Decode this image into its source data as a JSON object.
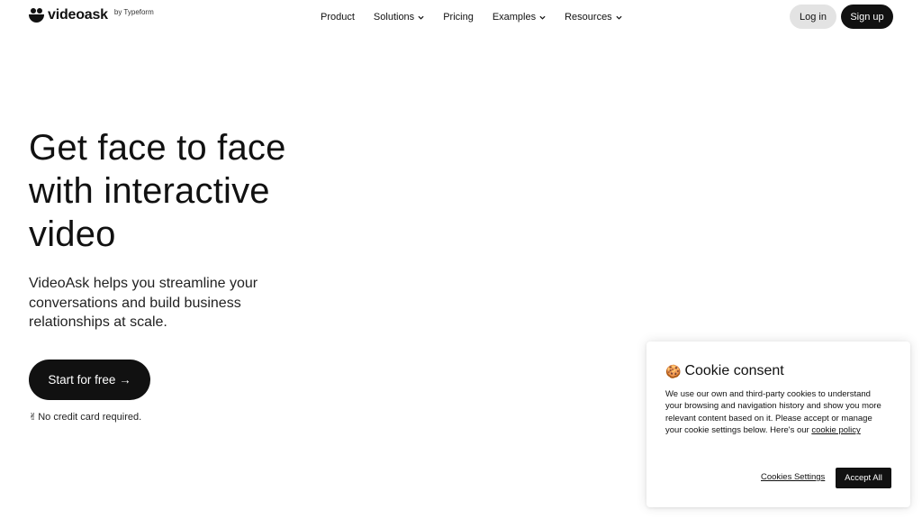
{
  "header": {
    "logo_word": "videoask",
    "logo_by": "by Typeform",
    "nav": [
      {
        "label": "Product",
        "has_dropdown": false
      },
      {
        "label": "Solutions",
        "has_dropdown": true
      },
      {
        "label": "Pricing",
        "has_dropdown": false
      },
      {
        "label": "Examples",
        "has_dropdown": true
      },
      {
        "label": "Resources",
        "has_dropdown": true
      }
    ],
    "login_label": "Log in",
    "signup_label": "Sign up"
  },
  "hero": {
    "title_lines": [
      "Get face to face",
      "with interactive",
      "video"
    ],
    "subtitle_lines": [
      "VideoAsk helps you streamline your",
      "conversations and build business",
      "relationships at scale."
    ],
    "cta_label": "Start for free →",
    "note_emoji": "✌",
    "note_text": "No credit card required."
  },
  "cookie": {
    "emoji": "🍪",
    "title": "Cookie consent",
    "body_lines": [
      "We use our own and third-party cookies to understand",
      "your browsing and navigation history and show you more",
      "relevant content based on it. Please accept or manage",
      "your cookie settings below. Here's our "
    ],
    "policy_link": "cookie policy",
    "settings_label": "Cookies Settings",
    "accept_label": "Accept All"
  },
  "colors": {
    "primary": "#111111",
    "login_bg": "#e3e3e3",
    "background": "#ffffff"
  }
}
